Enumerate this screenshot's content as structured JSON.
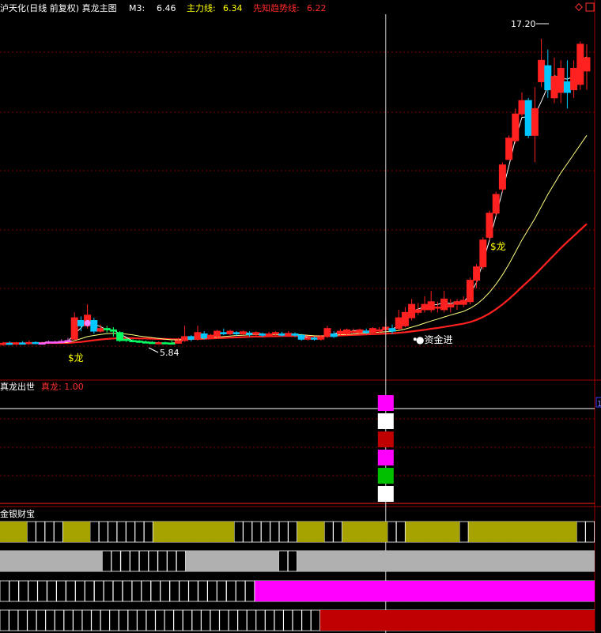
{
  "header": {
    "prefix": "泸天化(日线 前复权) 真龙主图",
    "items": [
      {
        "label": "M3:",
        "value": "6.46",
        "color": "#ffffff"
      },
      {
        "label": "主力线:",
        "value": "6.34",
        "color": "#ffff00"
      },
      {
        "label": "先知趋势线:",
        "value": "6.22",
        "color": "#ff2a2a"
      }
    ],
    "icons": [
      "diamond-icon",
      "window-icon"
    ]
  },
  "sub1": {
    "title": "真龙出世",
    "label": "真龙:",
    "value": "1.00",
    "tag": "1"
  },
  "sub2": {
    "title": "金银财宝"
  },
  "annotations": {
    "high": "17.20",
    "low": "5.84",
    "dragon1": "$龙",
    "dragon2": "$龙",
    "capital": "●资金进"
  },
  "colors": {
    "background": "#000000",
    "up": "#ff2020",
    "down": "#00c8ff",
    "grid": "#800000",
    "m3": "#ffffff",
    "main": "#ffff80",
    "trend": "#ff2020",
    "olive": "#a6a200",
    "gray": "#b0b0b0",
    "magenta": "#ff00ff",
    "darkred": "#c00000"
  },
  "chart_data": {
    "type": "candlestick",
    "ylim": [
      4.8,
      18.0
    ],
    "candles": [
      [
        5.8,
        5.85,
        5.9,
        5.75
      ],
      [
        5.85,
        5.83,
        5.92,
        5.78
      ],
      [
        5.83,
        5.86,
        5.9,
        5.78
      ],
      [
        5.86,
        5.84,
        5.93,
        5.8
      ],
      [
        5.84,
        5.88,
        5.95,
        5.8
      ],
      [
        5.88,
        5.85,
        5.92,
        5.82
      ],
      [
        5.85,
        5.86,
        5.9,
        5.8
      ],
      [
        5.86,
        5.9,
        5.95,
        5.83
      ],
      [
        5.9,
        5.88,
        5.94,
        5.84
      ],
      [
        5.88,
        5.92,
        6.0,
        5.85
      ],
      [
        5.92,
        5.95,
        6.05,
        5.88
      ],
      [
        6.0,
        6.8,
        7.0,
        5.95
      ],
      [
        6.7,
        6.5,
        6.85,
        6.3
      ],
      [
        6.5,
        6.9,
        7.3,
        6.4
      ],
      [
        6.7,
        6.3,
        6.8,
        6.2
      ],
      [
        6.3,
        6.4,
        6.55,
        6.25
      ],
      [
        6.4,
        6.35,
        6.5,
        6.25
      ],
      [
        6.35,
        6.3,
        6.45,
        6.1
      ],
      [
        6.25,
        5.95,
        6.3,
        5.9
      ],
      [
        6.0,
        5.95,
        6.05,
        5.9
      ],
      [
        5.95,
        5.93,
        6.0,
        5.88
      ],
      [
        5.93,
        5.9,
        5.97,
        5.86
      ],
      [
        5.9,
        5.88,
        5.95,
        5.85
      ],
      [
        5.88,
        5.86,
        5.93,
        5.84
      ],
      [
        5.86,
        5.87,
        5.92,
        5.84
      ],
      [
        5.87,
        5.86,
        5.91,
        5.84
      ],
      [
        5.86,
        5.85,
        5.95,
        5.84
      ],
      [
        5.85,
        5.95,
        6.05,
        5.84
      ],
      [
        5.95,
        6.1,
        6.5,
        5.9
      ],
      [
        6.1,
        6.0,
        6.15,
        5.92
      ],
      [
        6.0,
        6.25,
        6.5,
        5.95
      ],
      [
        6.2,
        6.05,
        6.3,
        5.98
      ],
      [
        6.05,
        6.15,
        6.2,
        6.0
      ],
      [
        6.1,
        6.3,
        6.35,
        6.05
      ],
      [
        6.25,
        6.2,
        6.4,
        6.15
      ],
      [
        6.2,
        6.3,
        6.35,
        6.15
      ],
      [
        6.25,
        6.2,
        6.3,
        6.12
      ],
      [
        6.2,
        6.28,
        6.33,
        6.15
      ],
      [
        6.22,
        6.18,
        6.3,
        6.1
      ],
      [
        6.18,
        6.25,
        6.3,
        6.12
      ],
      [
        6.2,
        6.15,
        6.25,
        6.08
      ],
      [
        6.15,
        6.2,
        6.28,
        6.1
      ],
      [
        6.2,
        6.25,
        6.3,
        6.12
      ],
      [
        6.2,
        6.15,
        6.28,
        6.1
      ],
      [
        6.15,
        6.22,
        6.3,
        6.1
      ],
      [
        6.2,
        6.15,
        6.26,
        6.08
      ],
      [
        6.15,
        6.0,
        6.2,
        5.95
      ],
      [
        6.0,
        6.05,
        6.1,
        5.95
      ],
      [
        6.05,
        6.0,
        6.1,
        5.95
      ],
      [
        6.0,
        6.1,
        6.15,
        5.95
      ],
      [
        6.1,
        6.4,
        6.5,
        6.05
      ],
      [
        6.2,
        6.1,
        6.3,
        6.05
      ],
      [
        6.2,
        6.3,
        6.4,
        6.15
      ],
      [
        6.2,
        6.35,
        6.4,
        6.15
      ],
      [
        6.25,
        6.3,
        6.4,
        6.2
      ],
      [
        6.25,
        6.35,
        6.4,
        6.2
      ],
      [
        6.3,
        6.25,
        6.4,
        6.2
      ],
      [
        6.25,
        6.4,
        6.45,
        6.2
      ],
      [
        6.3,
        6.35,
        6.45,
        6.25
      ],
      [
        6.35,
        6.45,
        6.8,
        6.3
      ],
      [
        6.4,
        6.3,
        6.55,
        6.2
      ],
      [
        6.4,
        6.8,
        7.1,
        6.35
      ],
      [
        6.5,
        7.0,
        7.2,
        6.45
      ],
      [
        6.8,
        7.3,
        7.5,
        6.7
      ],
      [
        7.0,
        7.1,
        7.35,
        6.9
      ],
      [
        7.1,
        7.3,
        7.6,
        7.0
      ],
      [
        7.1,
        7.4,
        7.8,
        7.0
      ],
      [
        7.2,
        7.2,
        7.4,
        7.0
      ],
      [
        7.1,
        7.5,
        7.8,
        7.0
      ],
      [
        7.2,
        7.3,
        7.5,
        7.0
      ],
      [
        7.3,
        7.4,
        7.5,
        7.1
      ],
      [
        7.3,
        7.45,
        7.6,
        7.2
      ],
      [
        7.4,
        8.2,
        8.3,
        7.3
      ],
      [
        8.2,
        8.7,
        8.8,
        7.9
      ],
      [
        8.7,
        9.7,
        9.8,
        8.6
      ],
      [
        9.8,
        10.7,
        10.8,
        9.7
      ],
      [
        10.7,
        11.4,
        11.5,
        10.6
      ],
      [
        11.6,
        12.5,
        12.6,
        11.5
      ],
      [
        12.7,
        13.5,
        13.6,
        12.7
      ],
      [
        13.4,
        14.4,
        14.6,
        13.3
      ],
      [
        14.4,
        14.9,
        15.2,
        14.3
      ],
      [
        14.9,
        13.6,
        15.0,
        13.5
      ],
      [
        13.6,
        14.6,
        15.4,
        12.6
      ],
      [
        15.6,
        16.4,
        17.2,
        15.4
      ],
      [
        16.2,
        15.3,
        16.8,
        15.0
      ],
      [
        15.0,
        15.8,
        16.5,
        14.8
      ],
      [
        15.2,
        16.1,
        16.4,
        14.8
      ],
      [
        15.6,
        15.2,
        16.4,
        14.6
      ],
      [
        15.3,
        16.1,
        16.4,
        15.0
      ],
      [
        15.5,
        17.0,
        17.1,
        15.3
      ],
      [
        16.0,
        16.5,
        17.0,
        15.3
      ]
    ],
    "m3": [
      5.83,
      5.85,
      5.85,
      5.85,
      5.86,
      5.86,
      5.86,
      5.88,
      5.88,
      5.9,
      5.92,
      6.2,
      6.42,
      6.73,
      6.57,
      6.47,
      6.35,
      6.35,
      6.2,
      6.07,
      5.94,
      5.93,
      5.9,
      5.88,
      5.87,
      5.86,
      5.86,
      5.89,
      5.97,
      6.02,
      6.12,
      6.13,
      6.13,
      6.17,
      6.22,
      6.27,
      6.23,
      6.26,
      6.22,
      6.24,
      6.19,
      6.2,
      6.2,
      6.2,
      6.21,
      6.17,
      6.12,
      6.07,
      6.03,
      6.05,
      6.17,
      6.2,
      6.27,
      6.25,
      6.32,
      6.33,
      6.3,
      6.33,
      6.33,
      6.4,
      6.37,
      6.52,
      6.7,
      7.03,
      7.13,
      7.2,
      7.27,
      7.3,
      7.37,
      7.33,
      7.4,
      7.38,
      7.68,
      8.12,
      8.87,
      9.7,
      10.6,
      11.53,
      12.47,
      13.47,
      14.27,
      14.3,
      14.37,
      14.87,
      15.43,
      15.83,
      15.73,
      15.7,
      15.8,
      16.4,
      16.53
    ],
    "main": [
      5.84,
      5.84,
      5.85,
      5.85,
      5.85,
      5.86,
      5.86,
      5.86,
      5.87,
      5.87,
      5.88,
      5.95,
      6.02,
      6.1,
      6.14,
      6.18,
      6.21,
      6.22,
      6.21,
      6.19,
      6.16,
      6.12,
      6.09,
      6.06,
      6.03,
      6.0,
      5.98,
      5.98,
      5.99,
      6.0,
      6.02,
      6.04,
      6.06,
      6.08,
      6.1,
      6.12,
      6.14,
      6.15,
      6.16,
      6.17,
      6.17,
      6.18,
      6.18,
      6.18,
      6.18,
      6.18,
      6.17,
      6.15,
      6.13,
      6.12,
      6.13,
      6.15,
      6.17,
      6.18,
      6.2,
      6.22,
      6.23,
      6.25,
      6.26,
      6.28,
      6.29,
      6.33,
      6.38,
      6.45,
      6.52,
      6.6,
      6.68,
      6.75,
      6.83,
      6.9,
      6.97,
      7.04,
      7.15,
      7.3,
      7.5,
      7.75,
      8.05,
      8.4,
      8.8,
      9.25,
      9.7,
      10.1,
      10.5,
      10.95,
      11.4,
      11.8,
      12.2,
      12.55,
      12.9,
      13.25,
      13.6
    ],
    "trend": [
      5.85,
      5.85,
      5.85,
      5.85,
      5.85,
      5.85,
      5.86,
      5.86,
      5.86,
      5.86,
      5.86,
      5.88,
      5.9,
      5.93,
      5.96,
      5.99,
      6.01,
      6.03,
      6.04,
      6.04,
      6.04,
      6.03,
      6.03,
      6.02,
      6.01,
      6.01,
      6.0,
      6.0,
      6.0,
      6.01,
      6.01,
      6.02,
      6.03,
      6.04,
      6.05,
      6.06,
      6.07,
      6.08,
      6.09,
      6.1,
      6.1,
      6.11,
      6.11,
      6.12,
      6.12,
      6.12,
      6.12,
      6.12,
      6.11,
      6.11,
      6.12,
      6.13,
      6.14,
      6.15,
      6.16,
      6.17,
      6.18,
      6.19,
      6.2,
      6.21,
      6.22,
      6.24,
      6.26,
      6.29,
      6.32,
      6.35,
      6.39,
      6.42,
      6.46,
      6.5,
      6.54,
      6.58,
      6.64,
      6.72,
      6.83,
      6.96,
      7.12,
      7.3,
      7.5,
      7.72,
      7.95,
      8.17,
      8.4,
      8.65,
      8.9,
      9.15,
      9.4,
      9.63,
      9.85,
      10.08,
      10.3
    ],
    "sub1_tower": [
      "#ff00ff",
      "#ffffff",
      "#c00000",
      "#ff00ff",
      "#00c000",
      "#ffffff"
    ],
    "sub2_rows": [
      {
        "color": "olive",
        "fill": [
          [
            0,
            2
          ],
          [
            7,
            9
          ],
          [
            17,
            25
          ],
          [
            33,
            35
          ],
          [
            38,
            42
          ],
          [
            45,
            50
          ],
          [
            52,
            63
          ]
        ],
        "cells": 66
      },
      {
        "color": "gray",
        "fill": [
          [
            0,
            10
          ],
          [
            20,
            29
          ],
          [
            32,
            63
          ]
        ],
        "cells": 64
      },
      {
        "color": "magenta",
        "fill": [
          [
            27,
            62
          ]
        ],
        "cells": 63
      },
      {
        "color": "darkred",
        "fill": [
          [
            35,
            64
          ]
        ],
        "cells": 65
      }
    ]
  }
}
